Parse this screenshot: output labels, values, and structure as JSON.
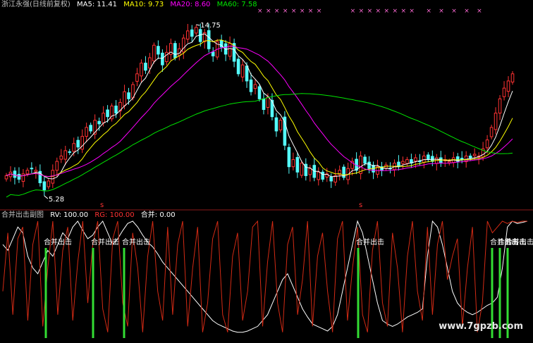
{
  "main_header": {
    "title": "浙江永强(日线前复权)",
    "ma5": "MA5: 11.41",
    "ma10": "MA10: 9.73",
    "ma20": "MA20: 8.60",
    "ma60": "MA60: 7.58"
  },
  "sub_header": {
    "title": "合并出击副图",
    "rv": "RV: 100.00",
    "rg": "RG: 100.00",
    "hb": "合并: 0.00"
  },
  "watermark": "www.7gpzb.com",
  "markers": {
    "s_label": "s",
    "x_label": "×"
  },
  "colors": {
    "bg": "#000000",
    "up": "#ff3232",
    "down": "#54fcfc",
    "ma5": "#ffffff",
    "ma10": "#ffff00",
    "ma20": "#ff00ff",
    "ma60": "#00e600",
    "rv": "#ffffff",
    "rg": "#d22a14",
    "signal": "#33dd33",
    "divider": "#8b1a1a",
    "header_title": "#c0c0c0"
  },
  "chart_data": [
    {
      "type": "candlestick",
      "title": "浙江永强(日线前复权)",
      "annotations": [
        {
          "text": "14.75",
          "at": "high",
          "x": 45
        },
        {
          "text": "5.28",
          "at": "low",
          "x": 9
        }
      ],
      "ma_series": [
        {
          "name": "MA5",
          "last": 11.41
        },
        {
          "name": "MA10",
          "last": 9.73
        },
        {
          "name": "MA20",
          "last": 8.6
        },
        {
          "name": "MA60",
          "last": 7.58
        }
      ],
      "ylim": [
        4.5,
        15.3
      ],
      "close": [
        6.1,
        6.3,
        6.0,
        5.9,
        6.2,
        6.4,
        6.5,
        6.4,
        5.7,
        5.3,
        5.8,
        6.4,
        6.9,
        7.2,
        7.5,
        7.4,
        7.9,
        7.7,
        8.3,
        8.8,
        8.6,
        9.2,
        9.0,
        9.6,
        9.4,
        10.0,
        9.6,
        10.2,
        10.8,
        10.4,
        11.2,
        11.8,
        12.4,
        12.0,
        12.7,
        13.4,
        12.9,
        12.3,
        13.0,
        13.5,
        12.7,
        13.2,
        13.8,
        14.2,
        13.9,
        14.4,
        13.6,
        14.1,
        13.2,
        12.8,
        13.6,
        13.3,
        12.9,
        13.5,
        12.5,
        11.8,
        12.3,
        11.4,
        10.8,
        11.2,
        10.4,
        9.8,
        10.5,
        9.4,
        8.6,
        9.2,
        7.8,
        6.6,
        7.0,
        6.3,
        6.8,
        6.1,
        6.5,
        6.0,
        6.3,
        5.9,
        6.2,
        5.8,
        6.1,
        6.4,
        6.0,
        6.5,
        6.9,
        6.4,
        7.2,
        6.8,
        6.5,
        6.3,
        6.6,
        6.4,
        6.7,
        6.5,
        6.8,
        6.6,
        6.9,
        7.0,
        6.8,
        7.1,
        6.9,
        7.2,
        7.0,
        6.9,
        7.1,
        6.8,
        7.0,
        6.9,
        7.1,
        6.9,
        7.0,
        7.2,
        7.1,
        7.3,
        7.2,
        7.6,
        8.1,
        8.8,
        9.6,
        10.4,
        11.0,
        11.4,
        11.8
      ],
      "volume_note": ""
    },
    {
      "type": "line",
      "title": "合并出击副图",
      "series": [
        {
          "name": "RV",
          "values": [
            80,
            75,
            85,
            95,
            90,
            70,
            60,
            55,
            65,
            75,
            70,
            80,
            90,
            85,
            95,
            100,
            92,
            85,
            88,
            95,
            100,
            90,
            80,
            85,
            92,
            98,
            100,
            95,
            88,
            82,
            78,
            72,
            65,
            60,
            55,
            50,
            45,
            40,
            35,
            30,
            25,
            20,
            15,
            12,
            10,
            8,
            6,
            5,
            5,
            6,
            8,
            10,
            15,
            20,
            30,
            40,
            50,
            55,
            45,
            35,
            25,
            18,
            12,
            10,
            8,
            6,
            10,
            20,
            40,
            60,
            80,
            100,
            90,
            70,
            50,
            30,
            15,
            12,
            10,
            12,
            15,
            18,
            20,
            22,
            25,
            70,
            100,
            95,
            80,
            60,
            40,
            30,
            25,
            22,
            20,
            22,
            25,
            28,
            30,
            35,
            60,
            95,
            100,
            98,
            99,
            100
          ]
        },
        {
          "name": "RG",
          "values": [
            40,
            90,
            20,
            85,
            95,
            15,
            80,
            100,
            10,
            60,
            100,
            20,
            75,
            95,
            15,
            65,
            100,
            30,
            80,
            100,
            25,
            5,
            85,
            100,
            30,
            10,
            90,
            60,
            5,
            70,
            100,
            40,
            15,
            95,
            20,
            80,
            100,
            10,
            60,
            95,
            5,
            30,
            85,
            100,
            20,
            5,
            70,
            90,
            15,
            40,
            95,
            100,
            10,
            65,
            100,
            30,
            5,
            80,
            95,
            20,
            50,
            100,
            10,
            70,
            90,
            40,
            5,
            85,
            100,
            15,
            60,
            95,
            20,
            5,
            75,
            100,
            30,
            10,
            90,
            60,
            5,
            70,
            100,
            40,
            15,
            95,
            20,
            80,
            100,
            50,
            70,
            85,
            10,
            60,
            95,
            5,
            30,
            100,
            90,
            95,
            100,
            98,
            100,
            99,
            100,
            100
          ]
        }
      ],
      "signals": [
        {
          "label": "合并出击",
          "index": 13
        },
        {
          "label": "合并出击",
          "index": 28
        },
        {
          "label": "合并出击",
          "index": 38
        },
        {
          "label": "合并出击",
          "index": 110
        },
        {
          "label": "合并出击",
          "index": 152
        },
        {
          "label": "合并出击",
          "index": 156
        },
        {
          "label": "合并出击",
          "index": 160
        }
      ],
      "ylim": [
        0,
        100
      ]
    }
  ]
}
